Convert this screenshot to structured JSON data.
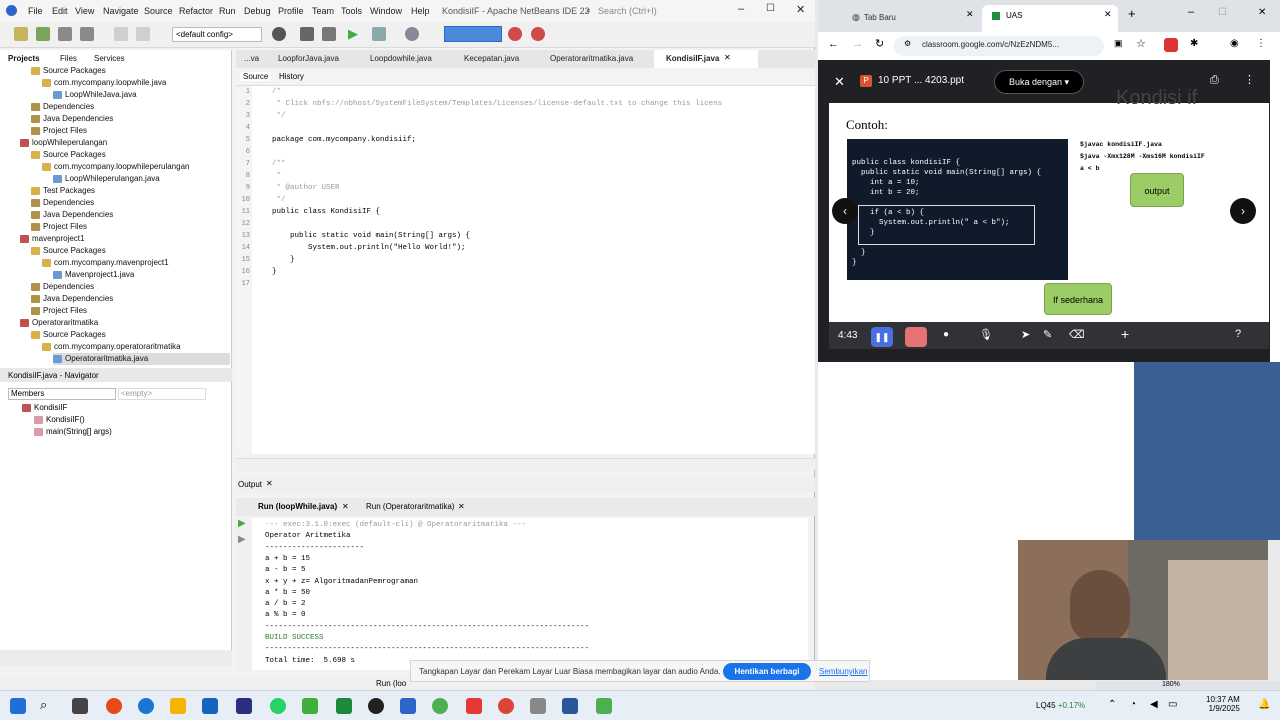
{
  "netbeans": {
    "menu": [
      "File",
      "Edit",
      "View",
      "Navigate",
      "Source",
      "Refactor",
      "Run",
      "Debug",
      "Profile",
      "Team",
      "Tools",
      "Window",
      "Help"
    ],
    "title": "KondisiIF - Apache NetBeans IDE 23",
    "search_placeholder": "Search (Ctrl+I)",
    "config_select": "<default config>",
    "panel_tabs": [
      "Projects",
      "Files",
      "Services"
    ],
    "tree": [
      {
        "label": "Source Packages",
        "indent": 3,
        "type": "pkg"
      },
      {
        "label": "com.mycompany.loopwhile.java",
        "indent": 4,
        "type": "pkg"
      },
      {
        "label": "LoopWhileJava.java",
        "indent": 5,
        "type": "file"
      },
      {
        "label": "Dependencies",
        "indent": 3,
        "type": "dep"
      },
      {
        "label": "Java Dependencies",
        "indent": 3,
        "type": "dep"
      },
      {
        "label": "Project Files",
        "indent": 3,
        "type": "dep"
      },
      {
        "label": "loopWhileperulangan",
        "indent": 2,
        "type": "proj"
      },
      {
        "label": "Source Packages",
        "indent": 3,
        "type": "pkg"
      },
      {
        "label": "com.mycompany.loopwhileperulangan",
        "indent": 4,
        "type": "pkg"
      },
      {
        "label": "LoopWhileperulangan.java",
        "indent": 5,
        "type": "file"
      },
      {
        "label": "Test Packages",
        "indent": 3,
        "type": "pkg"
      },
      {
        "label": "Dependencies",
        "indent": 3,
        "type": "dep"
      },
      {
        "label": "Java Dependencies",
        "indent": 3,
        "type": "dep"
      },
      {
        "label": "Project Files",
        "indent": 3,
        "type": "dep"
      },
      {
        "label": "mavenproject1",
        "indent": 2,
        "type": "proj"
      },
      {
        "label": "Source Packages",
        "indent": 3,
        "type": "pkg"
      },
      {
        "label": "com.mycompany.mavenproject1",
        "indent": 4,
        "type": "pkg"
      },
      {
        "label": "Mavenproject1.java",
        "indent": 5,
        "type": "file"
      },
      {
        "label": "Dependencies",
        "indent": 3,
        "type": "dep"
      },
      {
        "label": "Java Dependencies",
        "indent": 3,
        "type": "dep"
      },
      {
        "label": "Project Files",
        "indent": 3,
        "type": "dep"
      },
      {
        "label": "Operatoraritmatika",
        "indent": 2,
        "type": "proj"
      },
      {
        "label": "Source Packages",
        "indent": 3,
        "type": "pkg"
      },
      {
        "label": "com.mycompany.operatoraritmatika",
        "indent": 4,
        "type": "pkg"
      },
      {
        "label": "Operatoraritmatika.java",
        "indent": 5,
        "type": "file"
      }
    ],
    "navigator": {
      "title": "KondisiIF.java - Navigator",
      "members_label": "Members",
      "filter_placeholder": "<empty>",
      "items": [
        "KondisiIF",
        "KondisiIF()",
        "main(String[] args)"
      ]
    },
    "editor_tabs": [
      "...va",
      "LoopforJava.java",
      "Loopdowhile.java",
      "Kecepatan.java",
      "Operatoraritmatika.java",
      "KondisiIF.java"
    ],
    "editor_subtabs": [
      "Source",
      "History"
    ],
    "code_lines": [
      "/*",
      " * Click nbfs://nbhost/SystemFileSystem/Templates/Licenses/license-default.txt to change this licens",
      " */",
      "",
      "package com.mycompany.kondisiif;",
      "",
      "/**",
      " *",
      " * @author USER",
      " */",
      "public class KondisiIF {",
      "",
      "    public static void main(String[] args) {",
      "        System.out.println(\"Hello World!\");",
      "    }",
      "}",
      ""
    ],
    "output_title": "Output",
    "output_tabs": [
      "Run (loopWhile.java)",
      "Run (Operatoraritmatika)"
    ],
    "output_lines": [
      "--- exec:3.1.0:exec (default-cli) @ Operatoraritmatika ---",
      "Operator Aritmetika",
      "----------------------",
      "a + b = 15",
      "a - b = 5",
      "x + y + z= AlgoritmadanPemrograman",
      "a * b = 50",
      "a / b = 2",
      "a % b = 0",
      "------------------------------------------------------------------------",
      "BUILD SUCCESS",
      "------------------------------------------------------------------------",
      "Total time:  5.698 s"
    ],
    "status_run": "Run (loo"
  },
  "browser": {
    "tabs": [
      "Tab Baru",
      "UAS"
    ],
    "url": "classroom.google.com/c/NzEzNDM5...",
    "file_name": "10 PPT ... 4203.ppt",
    "open_with": "Buka dengan",
    "slide_heading": "Kondisi if",
    "slide_contoh": "Contoh:",
    "slide_code": [
      "public class kondisiIF {",
      "  public static void main(String[] args) {",
      "    int a = 10;",
      "    int b = 20;",
      "",
      "    if (a < b) {",
      "      System.out.println(\" a < b\");",
      "    }",
      "",
      "  }",
      "}"
    ],
    "slide_terminal": [
      "$javac kondisiIF.java",
      "$java -Xmx128M -Xms16M kondisiIF",
      " a < b"
    ],
    "slide_output_label": "output",
    "slide_if_label": "If sederhana",
    "timer": "4:43"
  },
  "share_banner": {
    "text": "Tangkapan Layar dan Perekam Layar Luar Biasa membagikan layar dan audio Anda.",
    "stop_button": "Hentikan berbagi",
    "hide_link": "Sembunyikan"
  },
  "taskbar": {
    "weather": "LQ45",
    "stock": "+0.17%",
    "time": "10:37 AM",
    "date": "1/9/2025",
    "zoom": "180%"
  },
  "colors": {
    "accent": "#1a73e8",
    "netbeans_blue": "#2f65ca",
    "slide_green": "#8bc34a",
    "code_bg": "#0f1b2a"
  }
}
